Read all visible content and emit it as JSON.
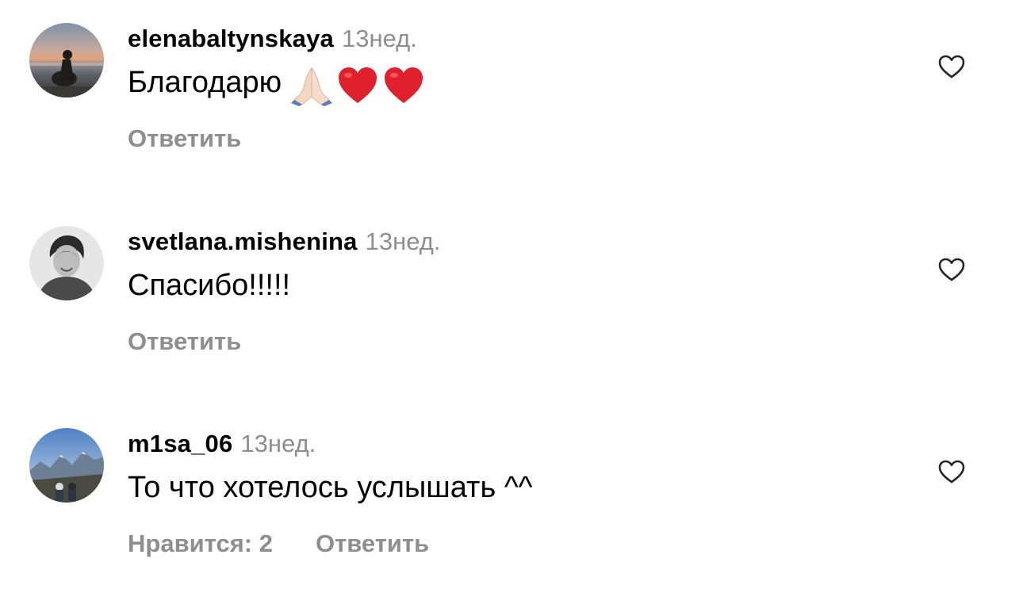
{
  "comments": [
    {
      "username": "elenabaltynskaya",
      "time": "13нед.",
      "text": "Благодарю",
      "emojis": [
        "folded-hands",
        "red-heart",
        "red-heart"
      ],
      "reply_label": "Ответить",
      "avatar": "sunset-beach-avatar"
    },
    {
      "username": "svetlana.mishenina",
      "time": "13нед.",
      "text": "Спасибо!!!!!",
      "reply_label": "Ответить",
      "avatar": "portrait-bw-avatar"
    },
    {
      "username": "m1sa_06",
      "time": "13нед.",
      "text": "То что хотелось услышать ^^",
      "likes_label": "Нравится: 2",
      "reply_label": "Ответить",
      "avatar": "mountains-avatar"
    }
  ],
  "icons": {
    "like": "heart-outline-icon"
  },
  "colors": {
    "text": "#000000",
    "secondary": "#8e8e8e",
    "heart_emoji": "#e0202c"
  }
}
